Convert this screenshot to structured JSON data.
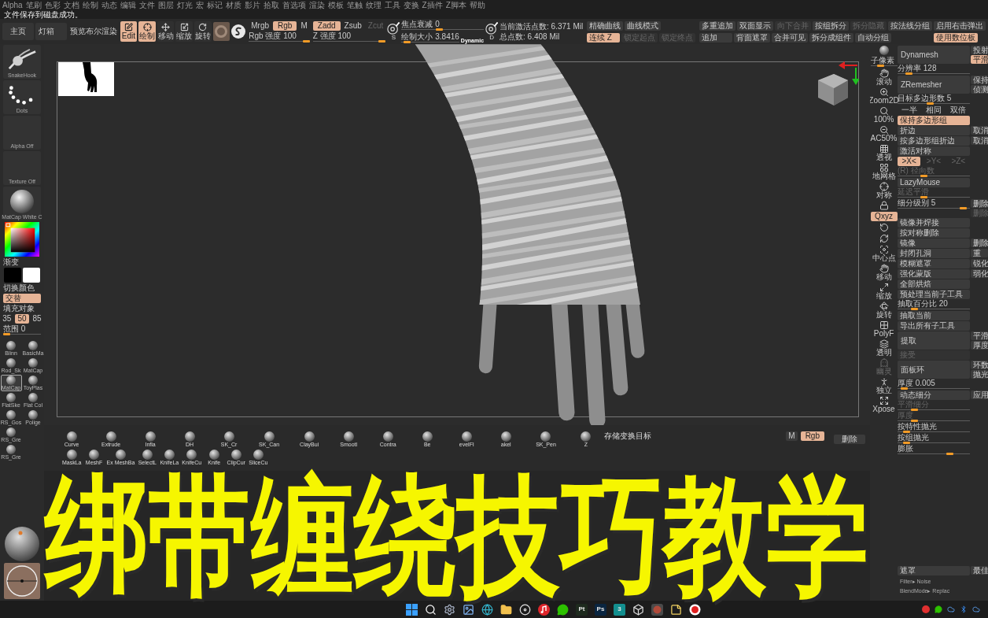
{
  "menu_bar": {
    "items": [
      "Alpha",
      "笔刷",
      "色彩",
      "文档",
      "绘制",
      "动态",
      "编辑",
      "文件",
      "图层",
      "灯光",
      "宏",
      "标记",
      "材质",
      "影片",
      "拾取",
      "首选项",
      "渲染",
      "模板",
      "笔触",
      "纹理",
      "工具",
      "变换",
      "Z插件",
      "Z脚本",
      "帮助"
    ]
  },
  "status_message": "文件保存到磁盘成功。",
  "toolbar": {
    "nav_buttons": [
      {
        "label": "主页"
      },
      {
        "label": "灯箱"
      }
    ],
    "preview_label": "预览布尔渲染",
    "mode_tools": [
      {
        "kind": "edit",
        "label": "Edit",
        "selected": true
      },
      {
        "kind": "draw",
        "label": "绘制",
        "selected": true
      },
      {
        "kind": "move",
        "label": "移动",
        "selected": false
      },
      {
        "kind": "scale",
        "label": "缩放",
        "selected": false
      },
      {
        "kind": "rotate",
        "label": "旋转",
        "selected": false
      }
    ],
    "rgb_modes": [
      {
        "label": "Mrgb",
        "selected": false
      },
      {
        "label": "Rgb",
        "selected": true
      },
      {
        "label": "M",
        "selected": false
      }
    ],
    "rgb_intensity": {
      "label": "Rgb 强度 100",
      "level": 1
    },
    "z_modes": [
      {
        "label": "Zadd",
        "selected": true,
        "disabled": false
      },
      {
        "label": "Zsub",
        "selected": false,
        "disabled": false
      },
      {
        "label": "Zcut",
        "selected": false,
        "disabled": true
      }
    ],
    "z_intensity": {
      "label": "Z 强度 100",
      "level": 1
    },
    "size_icon_label": "S",
    "focal_shift": {
      "label": "焦点衰减 0",
      "level": 0.46
    },
    "draw_size": {
      "label": "绘制大小 3.8416",
      "level": 0.04
    },
    "dynamic_label": "Dynamic",
    "dynamic_icon_label": "D",
    "stats": [
      "当前激活点数: 6.371 Mil",
      "总点数: 6.408 Mil"
    ],
    "button_groups": [
      {
        "rows": [
          [
            {
              "label": "精确曲线",
              "selected": false,
              "disabled": false
            },
            {
              "label": "曲线模式",
              "selected": false,
              "disabled": false
            }
          ],
          [
            {
              "label": "连续 Z",
              "selected": true,
              "disabled": false
            },
            {
              "label": "锁定起点",
              "selected": false,
              "disabled": true
            },
            {
              "label": "锁定终点",
              "selected": false,
              "disabled": true
            }
          ]
        ]
      },
      {
        "rows": [
          [
            {
              "label": "多重追加",
              "selected": false,
              "disabled": false
            },
            {
              "label": "双面显示",
              "selected": false,
              "disabled": false
            },
            {
              "label": "向下合并",
              "selected": false,
              "disabled": true
            },
            {
              "label": "按组拆分",
              "selected": false,
              "disabled": false
            },
            {
              "label": "拆分隐藏",
              "selected": false,
              "disabled": true
            },
            {
              "label": "按法线分组",
              "selected": false,
              "disabled": false
            }
          ],
          [
            {
              "label": "追加",
              "selected": false,
              "disabled": false
            },
            {
              "label": "背面遮罩",
              "selected": false,
              "disabled": false
            },
            {
              "label": "合并可见",
              "selected": false,
              "disabled": false
            },
            {
              "label": "拆分成组件",
              "selected": false,
              "disabled": false
            },
            {
              "label": "自动分组",
              "selected": false,
              "disabled": false
            }
          ]
        ]
      },
      {
        "rows": [
          [
            {
              "label": "启用右击弹出",
              "selected": false,
              "disabled": false
            }
          ],
          [
            {
              "label": "使用数位板",
              "selected": true,
              "disabled": false
            }
          ]
        ]
      }
    ]
  },
  "left_panel": {
    "brush": "SnakeHook",
    "stroke": "Dots",
    "alpha": "Alpha Off",
    "texture": "Texture Off",
    "material": "MatCap White C",
    "gradient_label": "渐变",
    "swatches": [
      {
        "color": "#000000"
      },
      {
        "color": "#ffffff"
      }
    ],
    "switch_color": "切换颜色",
    "alternate": {
      "label": "交替",
      "selected": true
    },
    "fill_object": "填充对象",
    "presets": [
      {
        "label": "35",
        "selected": false
      },
      {
        "label": "50",
        "selected": true
      },
      {
        "label": "85",
        "selected": false
      }
    ],
    "range": {
      "label": "范围 0",
      "level": 0
    },
    "material_rows": [
      {
        "items": [
          {
            "label": "Blinn",
            "selected": false
          },
          {
            "label": "BasicMa",
            "selected": false
          }
        ]
      },
      {
        "items": [
          {
            "label": "Rod_Sk",
            "selected": false
          },
          {
            "label": "MatCap",
            "selected": false
          }
        ]
      },
      {
        "items": [
          {
            "label": "MatCap",
            "selected": true
          },
          {
            "label": "ToyPlas",
            "selected": false
          }
        ]
      },
      {
        "items": [
          {
            "label": "FlatSke",
            "selected": false
          },
          {
            "label": "Flat Col",
            "selected": false
          }
        ]
      },
      {
        "items": [
          {
            "label": "RS_Gos",
            "selected": false
          },
          {
            "label": "Polige",
            "selected": false
          }
        ]
      },
      {
        "items": [
          {
            "label": "RS_Gre",
            "selected": false
          }
        ]
      },
      {
        "items": [
          {
            "label": "RS_Gre",
            "selected": false
          }
        ]
      }
    ]
  },
  "right_panel": {
    "shelf": [
      {
        "kind": "sphere",
        "selected": false,
        "disabled": false
      },
      {
        "kind": "slider",
        "label": "子像素",
        "level": 0.35,
        "selected": false,
        "disabled": false
      },
      {
        "kind": "hand",
        "label": "滚动",
        "selected": false,
        "disabled": false
      },
      {
        "kind": "zoom",
        "label": "Zoom2D",
        "selected": false,
        "disabled": false
      },
      {
        "kind": "actual",
        "label": "100%",
        "selected": false,
        "disabled": false
      },
      {
        "kind": "half",
        "label": "AC50%",
        "selected": false,
        "disabled": false
      },
      {
        "kind": "perspective",
        "label": "透视",
        "selected": false,
        "disabled": false
      },
      {
        "kind": "floor",
        "label": "地网格",
        "selected": false,
        "disabled": false
      },
      {
        "kind": "local",
        "label": "对称",
        "selected": false,
        "disabled": false
      },
      {
        "kind": "lock",
        "selected": false,
        "disabled": false
      },
      {
        "kind": "toggle",
        "label": "Qxyz",
        "selected": true,
        "disabled": false
      },
      {
        "kind": "rotate",
        "selected": false,
        "disabled": false
      },
      {
        "kind": "rotate2",
        "selected": false,
        "disabled": false
      },
      {
        "kind": "frame",
        "label": "中心点",
        "selected": false,
        "disabled": false
      },
      {
        "kind": "move",
        "label": "移动",
        "selected": false,
        "disabled": false
      },
      {
        "kind": "scale",
        "label": "缩放",
        "selected": false,
        "disabled": false
      },
      {
        "kind": "rotate3d",
        "label": "旋转",
        "selected": false,
        "disabled": false
      },
      {
        "kind": "polyframe",
        "label": "PolyF",
        "selected": false,
        "disabled": false
      },
      {
        "kind": "layers",
        "label": "透明",
        "selected": false,
        "disabled": false
      },
      {
        "kind": "ghost",
        "label": "幽灵",
        "selected": false,
        "disabled": true
      },
      {
        "kind": "solo",
        "label": "独立",
        "selected": false,
        "disabled": false
      },
      {
        "kind": "xpose",
        "label": "Xpose",
        "selected": false,
        "disabled": false
      }
    ],
    "settings": [
      {
        "kind": "big",
        "label": "Dynamesh",
        "side": [
          {
            "label": "投射",
            "selected": false
          },
          {
            "label": "平滑",
            "selected": true
          }
        ]
      },
      {
        "kind": "slider",
        "label": "分辨率 128",
        "level": 0.12
      },
      {
        "kind": "big",
        "label": "ZRemesher",
        "side": [
          {
            "label": "保持"
          },
          {
            "label": "侦测"
          }
        ]
      },
      {
        "kind": "slider",
        "label": "目标多边形数 5",
        "level": 0.45
      },
      {
        "kind": "group",
        "items": [
          {
            "label": "一半",
            "selected": false,
            "disabled": false
          },
          {
            "label": "相同",
            "selected": false,
            "disabled": false
          },
          {
            "label": "双倍",
            "selected": false,
            "disabled": false
          }
        ]
      },
      {
        "kind": "button",
        "label": "保持多边形组",
        "selected": true
      },
      {
        "kind": "button",
        "label": "折边",
        "side": [
          {
            "label": "取消"
          }
        ]
      },
      {
        "kind": "button",
        "label": "按多边形组折边",
        "side": [
          {
            "label": "取消"
          }
        ]
      },
      {
        "kind": "button",
        "label": "激活对称"
      },
      {
        "kind": "group",
        "items": [
          {
            "label": ">X<",
            "selected": true,
            "disabled": false
          },
          {
            "label": ">Y<",
            "selected": false,
            "disabled": true
          },
          {
            "label": ">Z<",
            "selected": false,
            "disabled": true
          }
        ]
      },
      {
        "kind": "slider",
        "label": "(R) 径向数",
        "level": 0.35,
        "disabled": true
      },
      {
        "kind": "button",
        "label": "LazyMouse"
      },
      {
        "kind": "slider",
        "label": "延迟平滑",
        "level": 0.35,
        "disabled": true
      },
      {
        "kind": "slider",
        "label": "细分级别 5",
        "level": 0.95,
        "side": [
          {
            "label": "删除",
            "disabled": false
          },
          {
            "label": "删除",
            "disabled": true
          }
        ]
      },
      {
        "kind": "button",
        "label": "镜像并焊接"
      },
      {
        "kind": "button",
        "label": "按对称删除"
      },
      {
        "kind": "button",
        "label": "镜像",
        "side": [
          {
            "label": "删除"
          }
        ]
      },
      {
        "kind": "button",
        "label": "封闭孔洞",
        "side": [
          {
            "label": "重"
          }
        ]
      },
      {
        "kind": "button",
        "label": "模糊遮罩",
        "side": [
          {
            "label": "锐化"
          }
        ]
      },
      {
        "kind": "button",
        "label": "强化蒙版",
        "side": [
          {
            "label": "弱化"
          }
        ]
      },
      {
        "kind": "button",
        "label": "全部烘焙"
      },
      {
        "kind": "button",
        "label": "预处理当前子工具"
      },
      {
        "kind": "slider",
        "label": "抽取百分比 20",
        "level": 0.2
      },
      {
        "kind": "button",
        "label": "抽取当前"
      },
      {
        "kind": "button",
        "label": "导出所有子工具"
      },
      {
        "kind": "big",
        "label": "提取",
        "side": [
          {
            "label": "平滑"
          },
          {
            "label": "厚度"
          }
        ]
      },
      {
        "kind": "button",
        "label": "接受",
        "disabled": true
      },
      {
        "kind": "big",
        "label": "面板环",
        "side": [
          {
            "label": "环数"
          },
          {
            "label": "抛光"
          }
        ]
      },
      {
        "kind": "slider",
        "label": "厚度 0.005",
        "level": 0.05
      },
      {
        "kind": "button",
        "label": "动态细分",
        "side": [
          {
            "label": "应用"
          }
        ]
      },
      {
        "kind": "slider",
        "label": "平滑细分",
        "level": 0.2,
        "disabled": true
      },
      {
        "kind": "slider",
        "label": "厚度",
        "level": 0.2,
        "disabled": true
      },
      {
        "kind": "slider",
        "label": "按特性抛光",
        "level": 0.08
      },
      {
        "kind": "slider",
        "label": "按组抛光",
        "level": 0.08
      },
      {
        "kind": "slider",
        "label": "膨胀",
        "level": 0.75
      }
    ],
    "bottom_settings": [
      {
        "kind": "button",
        "label": "遮罩",
        "side": [
          {
            "label": "最佳"
          }
        ]
      },
      {
        "kind": "text",
        "label": "Filter▸ Noise"
      },
      {
        "kind": "text",
        "label": "BlendMode▸ Replac"
      }
    ]
  },
  "brush_bar": {
    "rows": [
      {
        "items": [
          "Curve",
          "Extrude",
          "Infla",
          "DH",
          "SK_Cr",
          "SK_Can",
          "ClayBui",
          "Smootl",
          "Contra",
          "Be",
          "evelFl",
          "akel",
          "SK_Pen",
          "Z"
        ]
      },
      {
        "items": [
          "MaskLa",
          "MeshF",
          "Ex MeshBa",
          "SelectL",
          "KnifeLa",
          "KnifeCu",
          "Knife",
          "ClipCur",
          "SliceCu"
        ]
      }
    ],
    "save_target": "存储变换目标",
    "modes": [
      {
        "label": "M",
        "selected": false
      },
      {
        "label": "Rgb",
        "selected": true
      }
    ],
    "delete_button": {
      "label": "删除"
    }
  },
  "title": "绑带缠绕技巧教学",
  "taskbar": {
    "apps": [
      {
        "kind": "windows"
      },
      {
        "kind": "search"
      },
      {
        "kind": "gear"
      },
      {
        "kind": "photo"
      },
      {
        "kind": "browser"
      },
      {
        "kind": "folder"
      },
      {
        "kind": "player"
      },
      {
        "kind": "music"
      },
      {
        "kind": "chat"
      },
      {
        "kind": "tile",
        "label": "Pt",
        "color": "#1e2a1e"
      },
      {
        "kind": "tile",
        "label": "Ps",
        "color": "#0a2540"
      },
      {
        "kind": "tile",
        "label": "3",
        "color": "#138f8f"
      },
      {
        "kind": "cube"
      },
      {
        "kind": "app"
      },
      {
        "kind": "notes"
      },
      {
        "kind": "record"
      }
    ],
    "tray": [
      {
        "kind": "record"
      },
      {
        "kind": "chat"
      },
      {
        "kind": "cloud"
      },
      {
        "kind": "bluetooth"
      },
      {
        "kind": "cloud"
      }
    ]
  }
}
